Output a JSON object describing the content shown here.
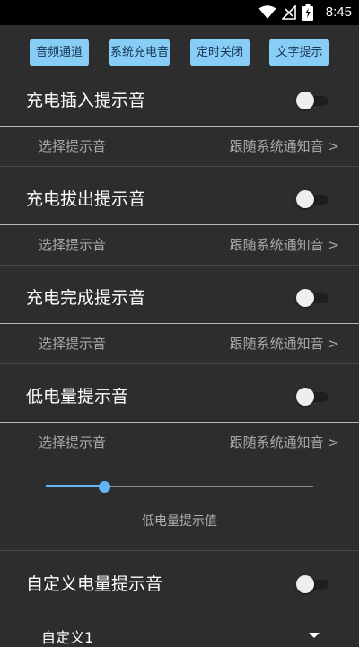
{
  "status": {
    "time": "8:45"
  },
  "tabs": [
    "音频通道",
    "系统充电音",
    "定时关闭",
    "文字提示"
  ],
  "sections": [
    {
      "title": "充电插入提示音",
      "enabled": false,
      "sub_label": "选择提示音",
      "sub_value": "跟随系统通知音 >"
    },
    {
      "title": "充电拔出提示音",
      "enabled": false,
      "sub_label": "选择提示音",
      "sub_value": "跟随系统通知音 >"
    },
    {
      "title": "充电完成提示音",
      "enabled": false,
      "sub_label": "选择提示音",
      "sub_value": "跟随系统通知音 >"
    },
    {
      "title": "低电量提示音",
      "enabled": false,
      "sub_label": "选择提示音",
      "sub_value": "跟随系统通知音 >"
    }
  ],
  "low_battery_slider": {
    "fraction": 0.22,
    "caption": "低电量提示值"
  },
  "custom": {
    "title": "自定义电量提示音",
    "enabled": false,
    "selected": "自定义1"
  },
  "colors": {
    "accent": "#64b5f6",
    "tab_bg": "#87cdf5",
    "background": "#2d2d2d"
  }
}
